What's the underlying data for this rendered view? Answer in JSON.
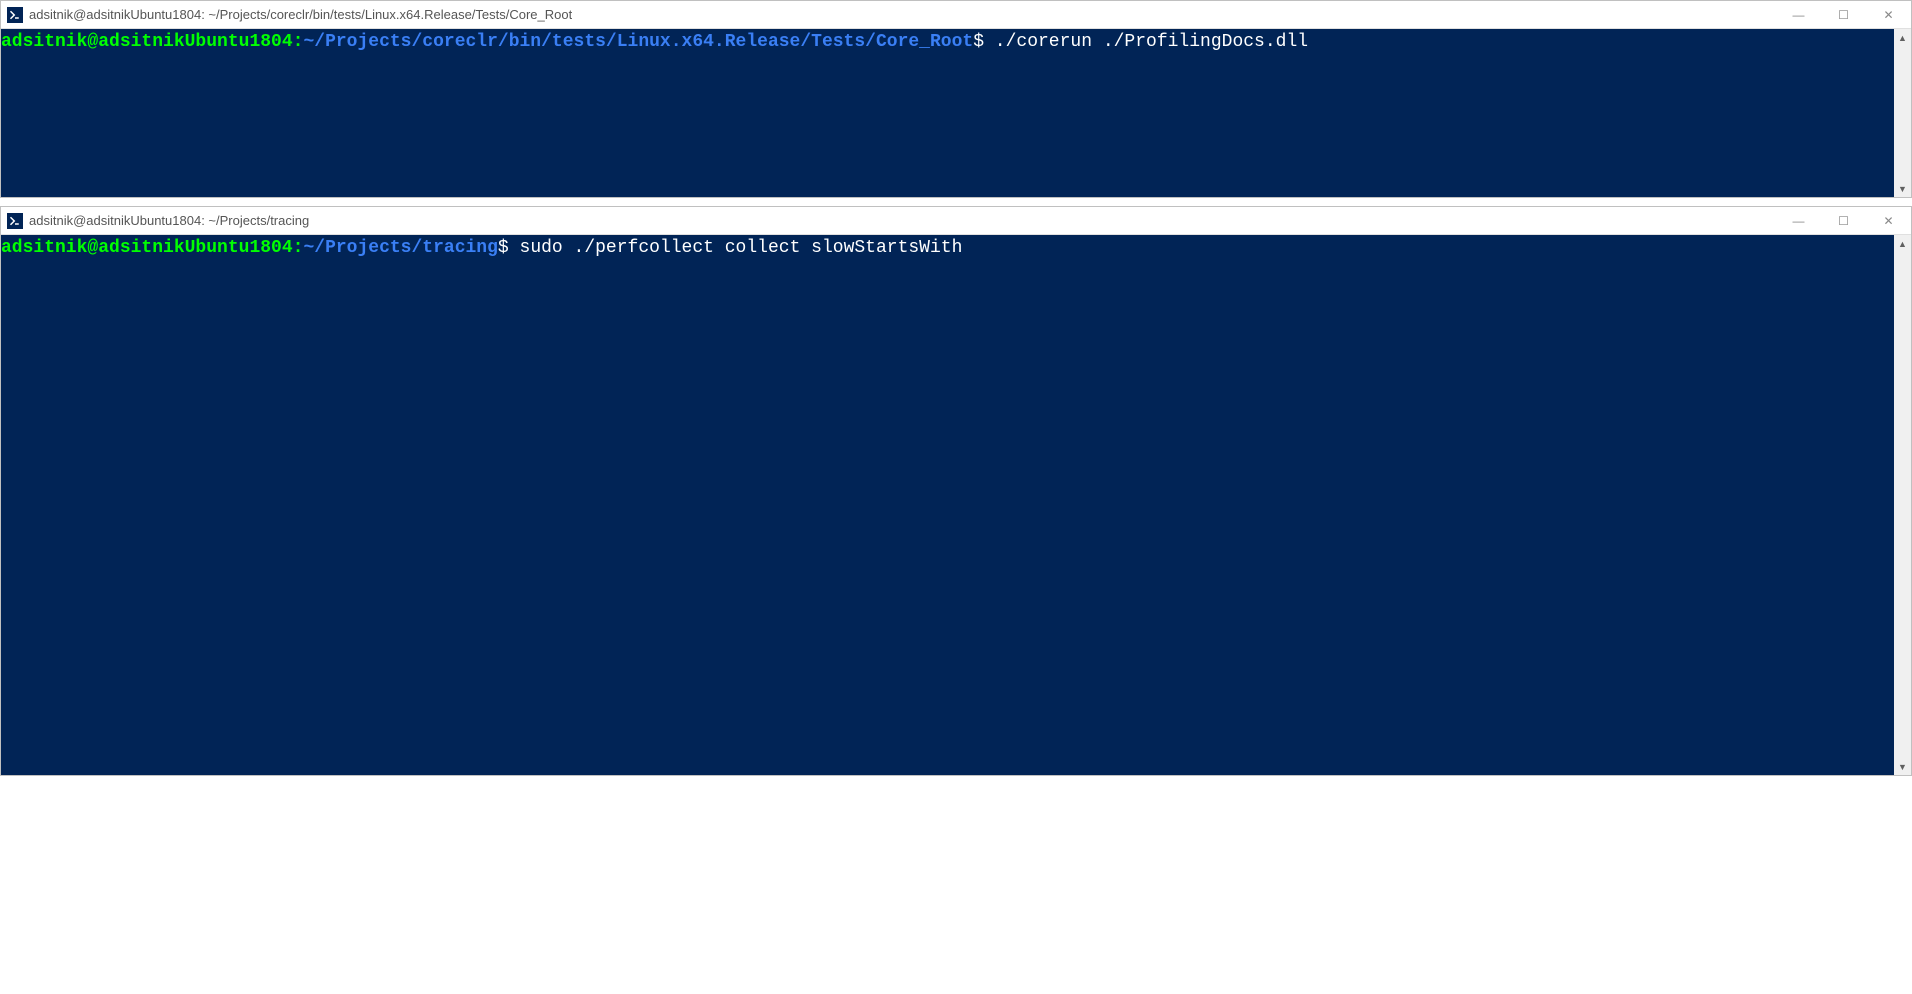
{
  "windows": [
    {
      "title": "adsitnik@adsitnikUbuntu1804: ~/Projects/coreclr/bin/tests/Linux.x64.Release/Tests/Core_Root",
      "prompt": {
        "user_host": "adsitnik@adsitnikUbuntu1804",
        "colon": ":",
        "path": "~/Projects/coreclr/bin/tests/Linux.x64.Release/Tests/Core_Root",
        "dollar": "$",
        "command": " ./corerun ./ProfilingDocs.dll"
      }
    },
    {
      "title": "adsitnik@adsitnikUbuntu1804: ~/Projects/tracing",
      "prompt": {
        "user_host": "adsitnik@adsitnikUbuntu1804",
        "colon": ":",
        "path": "~/Projects/tracing",
        "dollar": "$",
        "command": " sudo ./perfcollect collect slowStartsWith"
      }
    }
  ],
  "controls": {
    "minimize": "—",
    "maximize": "☐",
    "close": "✕"
  },
  "scroll": {
    "up": "▲",
    "down": "▼"
  }
}
